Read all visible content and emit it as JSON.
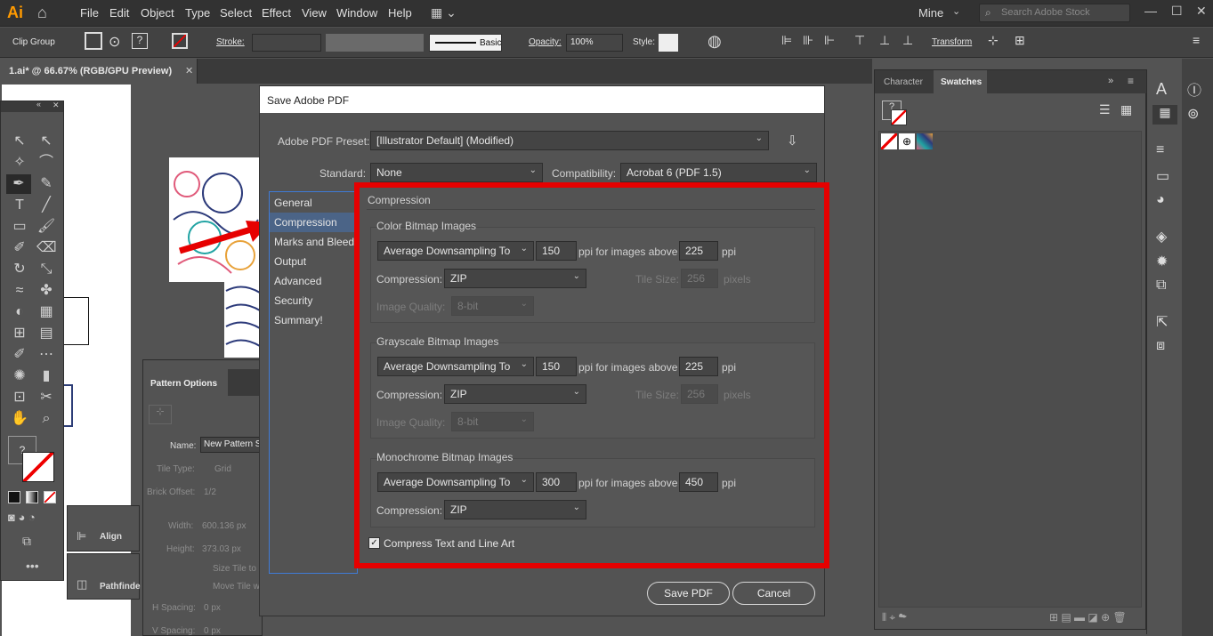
{
  "app": {
    "logo": "Ai",
    "workspace": "Mine",
    "search_placeholder": "Search Adobe Stock"
  },
  "menu": [
    "File",
    "Edit",
    "Object",
    "Type",
    "Select",
    "Effect",
    "View",
    "Window",
    "Help"
  ],
  "control_bar": {
    "selection": "Clip Group",
    "stroke_label": "Stroke:",
    "brush_label": "Basic",
    "opacity_label": "Opacity:",
    "opacity_value": "100%",
    "style_label": "Style:",
    "transform_label": "Transform"
  },
  "document": {
    "tab_title": "1.ai* @ 66.67% (RGB/GPU Preview)"
  },
  "dialog": {
    "title": "Save Adobe PDF",
    "preset_label": "Adobe PDF Preset:",
    "preset_value": "[Illustrator Default] (Modified)",
    "standard_label": "Standard:",
    "standard_value": "None",
    "compat_label": "Compatibility:",
    "compat_value": "Acrobat 6 (PDF 1.5)",
    "sections": [
      "General",
      "Compression",
      "Marks and Bleeds",
      "Output",
      "Advanced",
      "Security",
      "Summary!"
    ],
    "active_section": "Compression",
    "panel_title": "Compression",
    "color": {
      "heading": "Color Bitmap Images",
      "method": "Average Downsampling To",
      "ppi": "150",
      "above_label": "ppi for images above",
      "above": "225",
      "ppi_unit": "ppi",
      "compression_label": "Compression:",
      "compression": "ZIP",
      "tile_label": "Tile Size:",
      "tile": "256",
      "pixels": "pixels",
      "quality_label": "Image Quality:",
      "quality": "8-bit"
    },
    "gray": {
      "heading": "Grayscale Bitmap Images",
      "method": "Average Downsampling To",
      "ppi": "150",
      "above_label": "ppi for images above",
      "above": "225",
      "ppi_unit": "ppi",
      "compression_label": "Compression:",
      "compression": "ZIP",
      "tile_label": "Tile Size:",
      "tile": "256",
      "pixels": "pixels",
      "quality_label": "Image Quality:",
      "quality": "8-bit"
    },
    "mono": {
      "heading": "Monochrome Bitmap Images",
      "method": "Average Downsampling To",
      "ppi": "300",
      "above_label": "ppi for images above",
      "above": "450",
      "ppi_unit": "ppi",
      "compression_label": "Compression:",
      "compression": "ZIP"
    },
    "compress_text": "Compress Text and Line Art",
    "compress_text_checked": true,
    "save_button": "Save PDF",
    "cancel_button": "Cancel"
  },
  "right_panel": {
    "tabs": [
      "Character",
      "Swatches"
    ],
    "active_tab": "Swatches"
  },
  "pattern_options": {
    "title": "Pattern Options",
    "name_label": "Name:",
    "name_value": "New Pattern S",
    "tile_type_label": "Tile Type:",
    "tile_type_value": "Grid",
    "brick_offset_label": "Brick Offset:",
    "brick_offset_value": "1/2",
    "width_label": "Width:",
    "width_value": "600.136 px",
    "height_label": "Height:",
    "height_value": "373.03 px",
    "size_tile": "Size Tile to",
    "move_tile": "Move Tile w",
    "h_spacing_label": "H Spacing:",
    "h_spacing_value": "0 px",
    "v_spacing_label": "V Spacing:",
    "v_spacing_value": "0 px"
  },
  "mini_panels": {
    "align": "Align",
    "pathfinder": "Pathfinde"
  },
  "colors": {
    "highlight": "#e60000",
    "accent": "#ff6a00",
    "selection": "#4b6487"
  }
}
